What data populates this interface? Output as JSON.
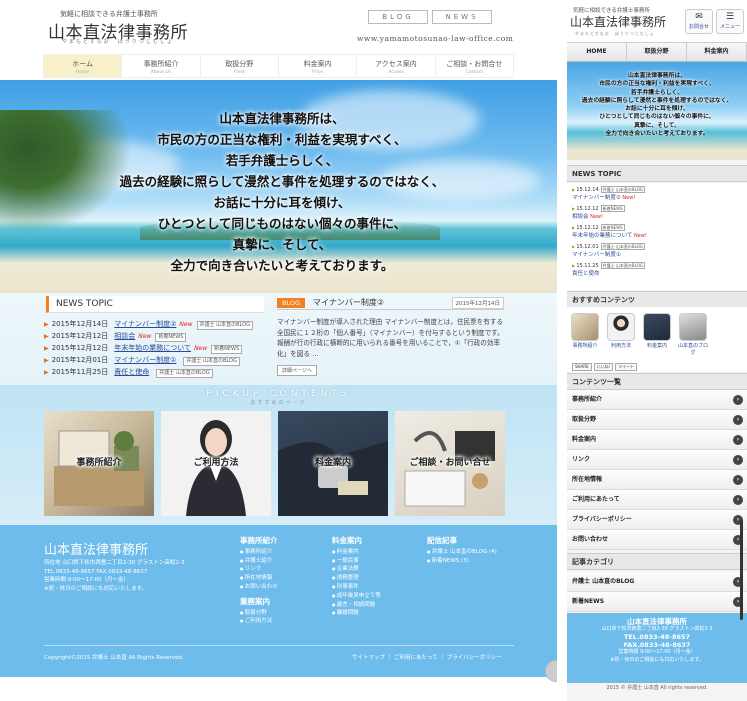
{
  "desktop": {
    "tagline": "気軽に相談できる弁護士事務所",
    "logo": "山本直法律事務所",
    "logo_kana": "やまもとすなお　ほうりつじむしょ",
    "blog_btn": "BLOG",
    "news_btn": "NEWS",
    "url": "www.yamamotosunao-law-office.com",
    "nav": [
      {
        "label": "ホーム",
        "sub": "Home"
      },
      {
        "label": "事務所紹介",
        "sub": "About Us"
      },
      {
        "label": "取扱分野",
        "sub": "Field"
      },
      {
        "label": "料金案内",
        "sub": "Price"
      },
      {
        "label": "アクセス案内",
        "sub": "Access"
      },
      {
        "label": "ご相談・お問合せ",
        "sub": "Contact"
      }
    ],
    "hero_lines": [
      "山本直法律事務所は、",
      "市民の方の正当な権利・利益を実現すべく、",
      "若手弁護士らしく、",
      "過去の経験に照らして漫然と事件を処理するのではなく、",
      "お話に十分に耳を傾け、",
      "ひとつとして同じものはない個々の事件に、",
      "真摯に、そして、",
      "全力で向き合いたいと考えております。"
    ],
    "news_title": "NEWS TOPIC",
    "news": [
      {
        "date": "2015年12月14日",
        "title": "マイナンバー制度②",
        "new": "New",
        "badge": "弁護士 山本直のBLOG"
      },
      {
        "date": "2015年12月12日",
        "title": "相談会",
        "new": "New",
        "badge": "新着NEWS"
      },
      {
        "date": "2015年12月12日",
        "title": "年末年始の業務について",
        "new": "New",
        "badge": "新着NEWS"
      },
      {
        "date": "2015年12月01日",
        "title": "マイナンバー制度①",
        "new": "",
        "badge": "弁護士 山本直のBLOG"
      },
      {
        "date": "2015年11月25日",
        "title": "責任と使命",
        "new": "",
        "badge": "弁護士 山本直のBLOG"
      }
    ],
    "blog": {
      "tag": "BLOG",
      "title": "マイナンバー制度②",
      "date": "2015年12月14日",
      "body": "マイナンバー制度が導入された理由 マイナンバー制度とは，住民票を有する全国民に１２桁の「個人番号」（マイナンバー）を付与するという制度です。 報酬が行の行政に横断的に用いられる番号を用いることで，①「行政の効率化」を図る …",
      "more": "詳細ページへ"
    },
    "pickup_title": "PICKUP CONTENTS",
    "pickup_sub": "おすすめのページ",
    "cards": [
      "事務所紹介",
      "ご利用方法",
      "料金案内",
      "ご相談・お問い合せ"
    ],
    "footer": {
      "logo": "山本直法律事務所",
      "address": "所在地 山口県下松市西豊二丁目2-30 グラストン高松2-3",
      "tel": "TEL.0833-48-8657 FAX.0833-48-8637",
      "hours": "営業時間 9:00〜17:00（月〜金）",
      "note": "※祝・休日のご相談にも対応いたします。",
      "col1_title": "事務所紹介",
      "col1": [
        "事務所紹介",
        "弁護士紹介",
        "リンク",
        "所在地情報",
        "お問い合わせ"
      ],
      "col1b_title": "業務案内",
      "col1b": [
        "取扱分野",
        "ご利用方法"
      ],
      "col2_title": "料金案内",
      "col2": [
        "料金案内",
        "一般民事",
        "企業法務",
        "債務整理",
        "刑事事件",
        "成年後見申立て等",
        "遺言・相続問題",
        "離婚問題"
      ],
      "col3_title": "配信記事",
      "col3": [
        "弁護士 山本直のBLOG (4)",
        "新着NEWS (3)"
      ],
      "copyright": "Copyright©2015 弁護士 山本直 All Rights Reserved.",
      "links": "サイトマップ ｜ ご利用にあたって ｜ プライバシーポリシー"
    }
  },
  "mobile": {
    "tagline": "気軽に相談できる弁護士事務所",
    "logo": "山本直法律事務所",
    "logo_kana": "やまもとすなお　ほうりつじむしょ",
    "contact_btn": "お問合せ",
    "menu_btn": "メニュー",
    "nav": [
      "HOME",
      "取扱分野",
      "料金案内"
    ],
    "hero_lines": [
      "山本直法律事務所は、",
      "市民の方の正当な権利・利益を実現すべく、",
      "若手弁護士らしく、",
      "過去の経験に照らして漫然と事件を処理するのではなく、",
      "お話に十分に耳を傾け、",
      "ひとつとして同じものはない個々の事件に、",
      "真摯に、そして、",
      "全力で向き合いたいと考えております。"
    ],
    "news_title": "NEWS TOPIC",
    "news": [
      {
        "date": "15.12.14",
        "badge": "弁護士 山本直のBLOG",
        "title": "マイナンバー制度②",
        "new": "New!"
      },
      {
        "date": "15.12.12",
        "badge": "新着NEWS",
        "title": "相談会",
        "new": "New!"
      },
      {
        "date": "15.12.12",
        "badge": "新着NEWS",
        "title": "年末年始の業務について",
        "new": "New!"
      },
      {
        "date": "15.12.01",
        "badge": "弁護士 山本直のBLOG",
        "title": "マイナンバー制度①",
        "new": ""
      },
      {
        "date": "15.11.25",
        "badge": "弁護士 山本直のBLOG",
        "title": "責任と使命",
        "new": ""
      }
    ],
    "rec_title": "おすすめコンテンツ",
    "rec": [
      "事務所紹介",
      "利用方法",
      "料金案内",
      "山本直のブログ"
    ],
    "share": [
      "SHARE",
      "いいね!",
      "ツイート"
    ],
    "list_title": "コンテンツ一覧",
    "list": [
      "事務所紹介",
      "取扱分野",
      "料金案内",
      "リンク",
      "所在地情報",
      "ご利用にあたって",
      "プライバシーポリシー",
      "お問い合わせ"
    ],
    "cat_title": "記事カテゴリ",
    "cats": [
      "弁護士 山本直のBLOG",
      "新着NEWS"
    ],
    "footer": {
      "name": "山本直法律事務所",
      "address": "山口県下松市西豊二丁目2-30 グラストン高松2-3",
      "tel": "TEL.0833-48-8657",
      "fax": "FAX.0833-48-8637",
      "hours": "営業時間 9:00〜17:00（月〜金）",
      "note": "※祝・休日のご相談にも対応いたします。"
    },
    "copyright": "2015 © 弁護士 山本直 All rights reserved."
  }
}
